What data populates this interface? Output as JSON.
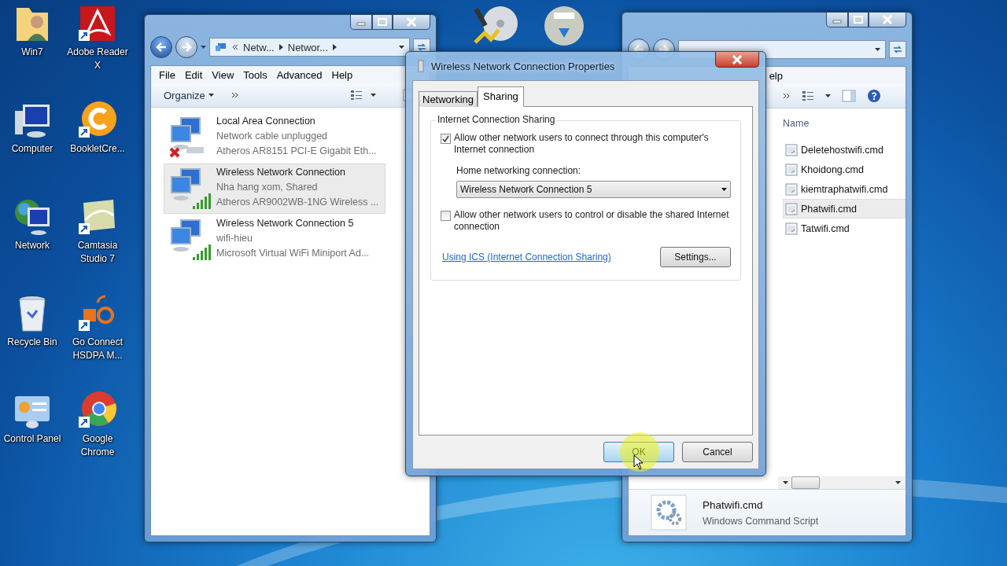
{
  "desktop_icons": [
    {
      "label": "Win7",
      "kind": "user-folder"
    },
    {
      "label": "Adobe Reader X",
      "kind": "pdf"
    },
    {
      "label": "Computer",
      "kind": "computer"
    },
    {
      "label": "BookletCre...",
      "kind": "orange-app"
    },
    {
      "label": "Network",
      "kind": "network"
    },
    {
      "label": "Camtasia Studio 7",
      "kind": "camtasia"
    },
    {
      "label": "Recycle Bin",
      "kind": "bin"
    },
    {
      "label": "Go Connect HSDPA M...",
      "kind": "modem"
    },
    {
      "label": "Control Panel",
      "kind": "control"
    },
    {
      "label": "Google Chrome",
      "kind": "browser"
    }
  ],
  "network_window": {
    "breadcrumb": [
      "Netw...",
      "Networ..."
    ],
    "menu": [
      "File",
      "Edit",
      "View",
      "Tools",
      "Advanced",
      "Help"
    ],
    "organize": "Organize",
    "connections": [
      {
        "name": "Local Area Connection",
        "status": "Network cable unplugged",
        "adapter": "Atheros AR8151 PCI-E Gigabit Eth...",
        "kind": "wired",
        "selected": false
      },
      {
        "name": "Wireless Network Connection",
        "status": "Nha hang xom, Shared",
        "adapter": "Atheros AR9002WB-1NG Wireless ...",
        "kind": "wireless",
        "selected": true
      },
      {
        "name": "Wireless Network Connection 5",
        "status": "wifi-hieu",
        "adapter": "Microsoft Virtual WiFi Miniport Ad...",
        "kind": "wireless",
        "selected": false
      }
    ]
  },
  "properties_dialog": {
    "title": "Wireless Network Connection Properties",
    "tabs": [
      {
        "label": "Networking",
        "selected": false
      },
      {
        "label": "Sharing",
        "selected": true
      }
    ],
    "group_title": "Internet Connection Sharing",
    "allow_connect": {
      "label": "Allow other network users to connect through this computer's Internet connection",
      "checked": true
    },
    "home_label": "Home networking connection:",
    "home_value": "Wireless Network Connection 5",
    "allow_control": {
      "label": "Allow other network users to control or disable the shared Internet connection",
      "checked": false
    },
    "link": "Using ICS (Internet Connection Sharing)",
    "settings_button": "Settings...",
    "buttons": [
      {
        "label": "OK",
        "selected": true
      },
      {
        "label": "Cancel",
        "selected": false
      }
    ]
  },
  "folder_window": {
    "help": "elp",
    "column": "Name",
    "files": [
      {
        "name": "Deletehostwifi.cmd",
        "selected": false
      },
      {
        "name": "Khoidong.cmd",
        "selected": false
      },
      {
        "name": "kiemtraphatwifi.cmd",
        "selected": false
      },
      {
        "name": "Phatwifi.cmd",
        "selected": true
      },
      {
        "name": "Tatwifi.cmd",
        "selected": false
      }
    ],
    "details": {
      "name": "Phatwifi.cmd",
      "type": "Windows Command Script"
    }
  }
}
